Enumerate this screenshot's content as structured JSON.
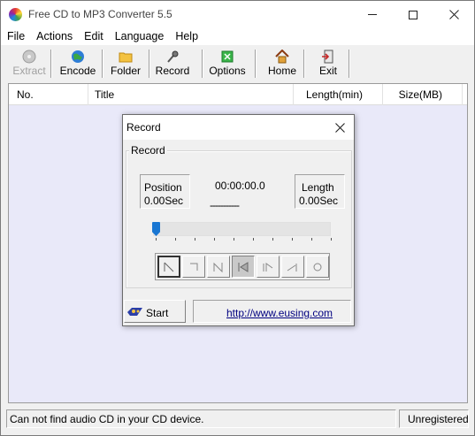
{
  "window": {
    "title": "Free CD to MP3 Converter 5.5",
    "minimize_glyph": "",
    "close_glyph": "✕"
  },
  "menu": [
    "File",
    "Actions",
    "Edit",
    "Language",
    "Help"
  ],
  "toolbar": {
    "extract": "Extract",
    "encode": "Encode",
    "folder": "Folder",
    "record": "Record",
    "options": "Options",
    "home": "Home",
    "exit": "Exit"
  },
  "table": {
    "columns": [
      "No.",
      "Title",
      "Length(min)",
      "Size(MB)"
    ]
  },
  "status": {
    "message": "Can not find audio CD in your CD device.",
    "registration": "Unregistered"
  },
  "record_dialog": {
    "title": "Record",
    "close_glyph": "✕",
    "group_label": "Record",
    "position_label": "Position",
    "position_value": "0.00Sec",
    "length_label": "Length",
    "length_value": "0.00Sec",
    "time": "00:00:00.0",
    "level": "-----------",
    "slider_position": 0,
    "start_label": "Start",
    "link": "http://www.eusing.com"
  }
}
